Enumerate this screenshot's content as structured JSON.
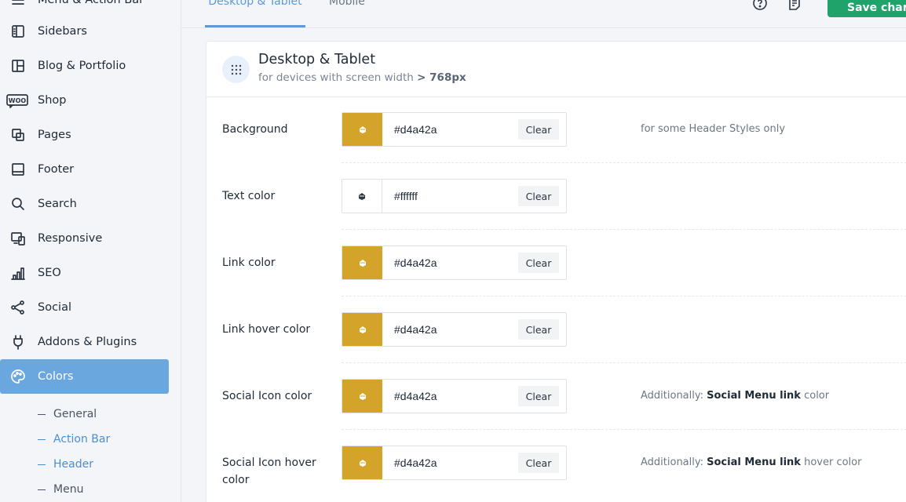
{
  "sidebar": {
    "partial_top_label": "Menu & Action Bar",
    "items": [
      {
        "label": "Sidebars",
        "icon": "sidebar-icon"
      },
      {
        "label": "Blog & Portfolio",
        "icon": "layout-grid-icon"
      },
      {
        "label": "Shop",
        "icon": "woo-icon"
      },
      {
        "label": "Pages",
        "icon": "pages-icon"
      },
      {
        "label": "Footer",
        "icon": "footer-icon"
      },
      {
        "label": "Search",
        "icon": "search-icon"
      },
      {
        "label": "Responsive",
        "icon": "responsive-icon"
      },
      {
        "label": "SEO",
        "icon": "seo-chart-icon"
      },
      {
        "label": "Social",
        "icon": "share-icon"
      },
      {
        "label": "Addons & Plugins",
        "icon": "plug-icon"
      },
      {
        "label": "Colors",
        "icon": "palette-icon",
        "active": true
      }
    ],
    "subitems": [
      {
        "label": "General"
      },
      {
        "label": "Action Bar",
        "highlighted": true
      },
      {
        "label": "Header",
        "highlighted": true
      },
      {
        "label": "Menu"
      }
    ]
  },
  "tabs": [
    {
      "label": "Desktop & Tablet",
      "active": true
    },
    {
      "label": "Mobile"
    }
  ],
  "toolbar": {
    "help_icon": "help-circle-icon",
    "notes_icon": "notes-icon",
    "save_label": "Save changes"
  },
  "panel": {
    "title": "Desktop & Tablet",
    "subtitle_prefix": "for devices with screen width",
    "subtitle_value": "> 768px",
    "icon": "dots-grid-icon"
  },
  "rows": [
    {
      "label": "Background",
      "value": "#d4a42a",
      "swatch": "#d4a42a",
      "clear": "Clear",
      "note": "for some Header Styles only"
    },
    {
      "label": "Text color",
      "value": "#ffffff",
      "swatch": "#ffffff",
      "clear": "Clear"
    },
    {
      "label": "Link color",
      "value": "#d4a42a",
      "swatch": "#d4a42a",
      "clear": "Clear"
    },
    {
      "label": "Link hover color",
      "value": "#d4a42a",
      "swatch": "#d4a42a",
      "clear": "Clear"
    },
    {
      "label": "Social Icon color",
      "value": "#d4a42a",
      "swatch": "#d4a42a",
      "clear": "Clear",
      "note_prefix": "Additionally:",
      "note_bold": "Social Menu link",
      "note_suffix": "color"
    },
    {
      "label": "Social Icon hover color",
      "value": "#d4a42a",
      "swatch": "#d4a42a",
      "clear": "Clear",
      "note_prefix": "Additionally:",
      "note_bold": "Social Menu link",
      "note_suffix": "hover color"
    }
  ],
  "colors": {
    "accent": "#6aa7df",
    "save": "#1fa36b",
    "gold": "#d4a42a"
  }
}
